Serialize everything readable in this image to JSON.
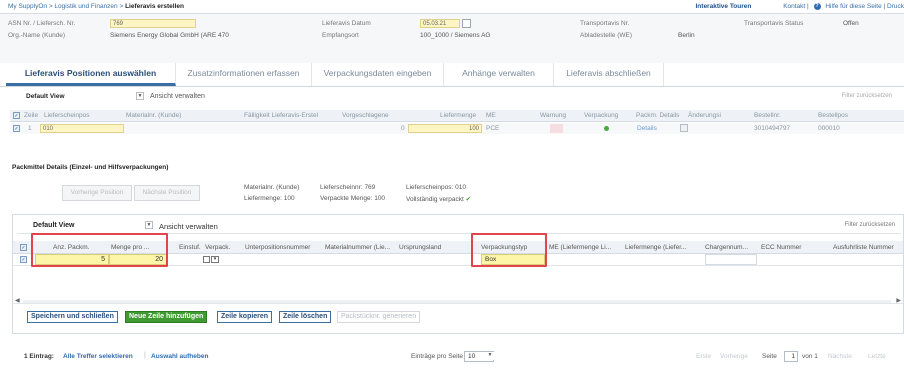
{
  "breadcrumb": {
    "path": "My SupplyOn > Logistik und Finanzen >",
    "current": "Lieferavis erstellen"
  },
  "top_links": {
    "tours": "Interaktive Touren",
    "contact": "Kontakt |",
    "help": "Hilfe für diese Seite | Druck"
  },
  "header": {
    "asn_label": "ASN Nr. / Liefersch. Nr.",
    "asn_value": "769",
    "org_label": "Org.-Name (Kunde)",
    "org_value": "Siemens Energy Global GmbH (ARE 470",
    "date_label": "Lieferavis Datum",
    "date_value": "05.03.21",
    "receiver_label": "Empfangsort",
    "receiver_value": "100_1000 / Siemens AG",
    "transport_label": "Transportavis Nr.",
    "unload_label": "Abladestelle (WE)",
    "unload_value": "Berlin",
    "status_label": "Transportavis Status",
    "status_value": "Offen"
  },
  "tabs": [
    {
      "label": "Lieferavis Positionen auswählen"
    },
    {
      "label": "Zusatzinformationen erfassen"
    },
    {
      "label": "Verpackungsdaten eingeben"
    },
    {
      "label": "Anhänge verwalten"
    },
    {
      "label": "Lieferavis abschließen"
    }
  ],
  "positions": {
    "view_label": "Default View",
    "manage_views": "Ansicht verwalten",
    "reset_filter": "Filter zurücksetzen",
    "columns": [
      "Zeile",
      "Lieferscheinpos",
      "Materialnr. (Kunde)",
      "Fälligkeit Lieferavis-Erstel",
      "Vorgeschlagene",
      "Liefermenge",
      "ME",
      "Warnung",
      "Verpackung",
      "Packm. Details",
      "Änderungsi",
      "Bestellnr.",
      "Bestellpos"
    ],
    "row": {
      "line": "1",
      "pos": "010",
      "suggested": "0",
      "qty": "100",
      "unit": "PCE",
      "details": "Details",
      "order": "3010494797",
      "order_pos": "000010"
    }
  },
  "packing": {
    "title": "Packmittel Details (Einzel- und Hilfsverpackungen)",
    "prev_btn": "Vorherige Position",
    "next_btn": "Nächste Position",
    "mat_label": "Materialnr. (Kunde)",
    "qty_label": "Liefermenge: 100",
    "slip_label": "Lieferscheinnr: 769",
    "packed_label": "Verpackte Menge: 100",
    "slippos_label": "Lieferscheinpos: 010",
    "complete_label": "Vollständig verpackt",
    "view_label": "Default View",
    "manage_views": "Ansicht verwalten",
    "reset_filter": "Filter zurücksetzen",
    "columns": [
      "Anz. Packm.",
      "Menge pro ...",
      "Einstuf.",
      "Verpack.",
      "Unterpositionsnummer",
      "Materialnummer (Lie...",
      "Ursprungsland",
      "Verpackungstyp",
      "ME (Liefermenge Li...",
      "Liefermenge (Liefer...",
      "Chargennum...",
      "ECC Nummer",
      "Ausfuhrliste Nummer"
    ],
    "row": {
      "count": "5",
      "per": "20",
      "type": "Box"
    }
  },
  "actions": {
    "save_close": "Speichern und schließen",
    "add_row": "Neue Zeile hinzufügen",
    "copy_row": "Zeile kopieren",
    "delete_row": "Zeile löschen",
    "generate": "Packstücknr. generieren"
  },
  "footer": {
    "count": "1 Eintrag:",
    "select_all": "Alle Treffer selektieren",
    "deselect": "Auswahl aufheben",
    "per_page_label": "Einträge pro Seite",
    "per_page": "10",
    "first": "Erste",
    "prev": "Vorherige",
    "page_label": "Seite",
    "page": "1",
    "of": "von 1",
    "next": "Nächste",
    "last": "Letzte"
  },
  "colors": {
    "accent": "#3a6ea5",
    "highlight": "#e2444c",
    "field": "#fdf6a8",
    "add_button": "#3f9b31"
  }
}
